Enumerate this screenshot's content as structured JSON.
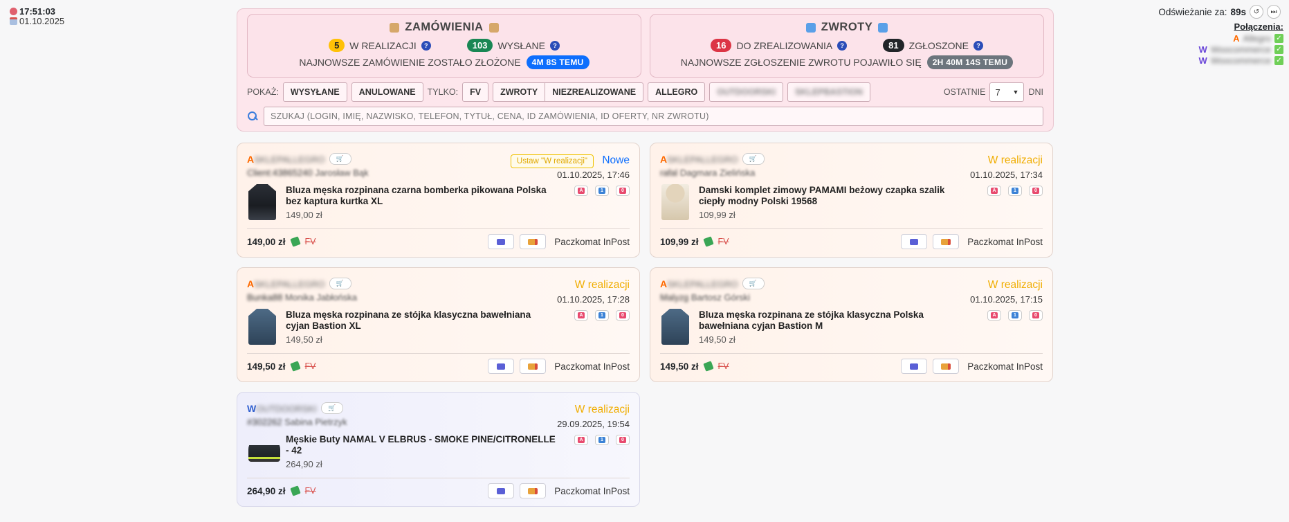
{
  "clock": {
    "time": "17:51:03",
    "date": "01.10.2025"
  },
  "refresh": {
    "label": "Odświeżanie za:",
    "seconds": "89s"
  },
  "connections": {
    "title": "Połączenia:",
    "items": [
      {
        "letter": "A",
        "color": "#ff6a00",
        "name": "Allegro"
      },
      {
        "letter": "W",
        "color": "#6a46d8",
        "name": "Woocommerce"
      },
      {
        "letter": "W",
        "color": "#6a46d8",
        "name": "Woocommerce"
      }
    ]
  },
  "orders": {
    "title": "ZAMÓWIENIA",
    "in_progress_count": "5",
    "in_progress_label": "W REALIZACJI",
    "sent_count": "103",
    "sent_label": "WYSŁANE",
    "latest_label": "NAJNOWSZE ZAMÓWIENIE ZOSTAŁO ZŁOŻONE",
    "latest_time": "4M 8S TEMU"
  },
  "returns": {
    "title": "ZWROTY",
    "todo_count": "16",
    "todo_label": "DO ZREALIZOWANIA",
    "reported_count": "81",
    "reported_label": "ZGŁOSZONE",
    "latest_label": "NAJNOWSZE ZGŁOSZENIE ZWROTU POJAWIŁO SIĘ",
    "latest_time": "2H 40M 14S TEMU"
  },
  "filters": {
    "show_label": "POKAŻ:",
    "sent": "WYSYŁANE",
    "cancelled": "ANULOWANE",
    "only_label": "TYLKO:",
    "fv": "FV",
    "returns": "ZWROTY",
    "unrealized": "NIEZREALIZOWANE",
    "allegro": "ALLEGRO",
    "blur1": "OUTDOORSKI",
    "blur2": "SKLEPBASTION",
    "last_label": "OSTATNIE",
    "days_value": "7",
    "days_label": "DNI"
  },
  "search": {
    "placeholder": "SZUKAJ (LOGIN, IMIĘ, NAZWISKO, TELEFON, TYTUŁ, CENA, ID ZAMÓWIENIA, ID OFERTY, NR ZWROTU)"
  },
  "set_status_label": "Ustaw \"W realizacji\"",
  "orders_list": [
    {
      "platform": "A",
      "store": "SKLEPALLEGRO",
      "buyer_login": "Client:43865240",
      "buyer_name": "Jarosław Bąk",
      "status": "Nowe",
      "date": "01.10.2025, 17:46",
      "title": "Bluza męska rozpinana czarna bomberka pikowana Polska bez kaptura kurtka XL",
      "price": "149,00 zł",
      "total": "149,00 zł",
      "fv": "FV",
      "shipping": "Paczkomat InPost"
    },
    {
      "platform": "A",
      "store": "SKLEPALLEGRO",
      "buyer_login": "rafal",
      "buyer_name": "Dagmara Zielińska",
      "status": "W realizacji",
      "date": "01.10.2025, 17:34",
      "title": "Damski komplet zimowy PAMAMI beżowy czapka szalik ciepły modny Polski 19568",
      "price": "109,99 zł",
      "total": "109,99 zł",
      "fv": "FV",
      "shipping": "Paczkomat InPost"
    },
    {
      "platform": "A",
      "store": "SKLEPALLEGRO",
      "buyer_login": "Bunka88",
      "buyer_name": "Monika Jabłońska",
      "status": "W realizacji",
      "date": "01.10.2025, 17:28",
      "title": "Bluza męska rozpinana ze stójka klasyczna bawełniana cyjan Bastion XL",
      "price": "149,50 zł",
      "total": "149,50 zł",
      "fv": "FV",
      "shipping": "Paczkomat InPost"
    },
    {
      "platform": "A",
      "store": "SKLEPALLEGRO",
      "buyer_login": "Malyzg",
      "buyer_name": "Bartosz Górski",
      "status": "W realizacji",
      "date": "01.10.2025, 17:15",
      "title": "Bluza męska rozpinana ze stójka klasyczna Polska bawełniana cyjan Bastion M",
      "price": "149,50 zł",
      "total": "149,50 zł",
      "fv": "FV",
      "shipping": "Paczkomat InPost"
    },
    {
      "platform": "W",
      "store": "OUTDOORSKI",
      "buyer_login": "#302262",
      "buyer_name": "Sabina Pietrzyk",
      "status": "W realizacji",
      "date": "29.09.2025, 19:54",
      "title": "Męskie Buty NAMAL V ELBRUS - SMOKE PINE/CITRONELLE - 42",
      "price": "264,90 zł",
      "total": "264,90 zł",
      "fv": "FV",
      "shipping": "Paczkomat InPost"
    }
  ]
}
